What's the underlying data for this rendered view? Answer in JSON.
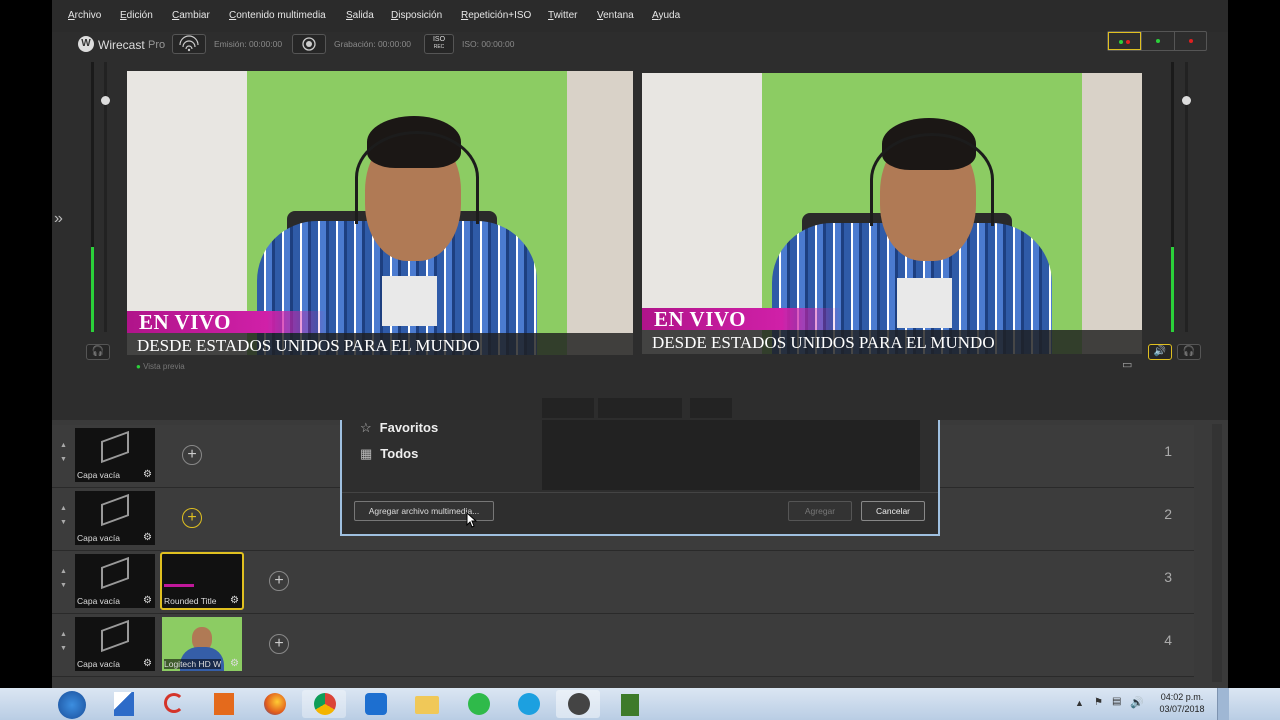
{
  "menu": [
    "Archivo",
    "Edición",
    "Cambiar",
    "Contenido multimedia",
    "Salida",
    "Disposición",
    "Repetición+ISO",
    "Twitter",
    "Ventana",
    "Ayuda"
  ],
  "toolbar": {
    "app_name": "Wirecast",
    "app_edition": "Pro",
    "stream_label": "Emisión: 00:00:00",
    "record_label": "Grabación: 00:00:00",
    "iso_badge_top": "ISO",
    "iso_badge_bottom": "REC",
    "iso_label": "ISO: 00:00:00"
  },
  "preview": {
    "lower_third_title": "EN VIVO",
    "lower_third_sub": "DESDE ESTADOS UNIDOS PARA EL MUNDO",
    "preview_label": "Vista previa"
  },
  "live": {
    "lower_third_title": "EN VIVO",
    "lower_third_sub": "DESDE ESTADOS UNIDOS PARA EL MUNDO"
  },
  "dialog": {
    "items": [
      "Favoritos",
      "Todos"
    ],
    "add_media_button": "Agregar archivo multimedia...",
    "add_button": "Agregar",
    "cancel_button": "Cancelar"
  },
  "layers": [
    {
      "number": "1",
      "shots": [
        {
          "label": "Capa vacía"
        }
      ]
    },
    {
      "number": "2",
      "shots": [
        {
          "label": "Capa vacía"
        }
      ]
    },
    {
      "number": "3",
      "shots": [
        {
          "label": "Capa vacía"
        },
        {
          "label": "Rounded Title"
        }
      ]
    },
    {
      "number": "4",
      "shots": [
        {
          "label": "Capa vacía"
        },
        {
          "label": "Logitech HD W"
        }
      ]
    }
  ],
  "clock": {
    "time": "04:02 p.m.",
    "date": "03/07/2018"
  },
  "colors": {
    "accent_yellow": "#e0c020",
    "live_red": "#e02020",
    "meter_green": "#2bd13a",
    "lower_third_magenta": "#c0189a"
  },
  "icons": [
    "start-icon",
    "wirecast-icon",
    "ccleaner-icon",
    "office-icon",
    "firefox-icon",
    "chrome-icon",
    "teamviewer-icon",
    "folder-icon",
    "whatsapp-icon",
    "skype-icon",
    "wirecast-taskbar-icon",
    "camtasia-icon"
  ]
}
